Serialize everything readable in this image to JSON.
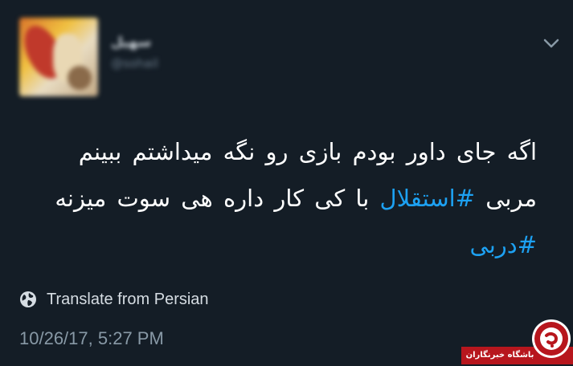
{
  "tweet": {
    "display_name": "سهیل",
    "handle": "@sohail",
    "body": {
      "line1": "اگه جای داور بودم بازی رو نگه میداشتم ببینم",
      "line2_prefix": "مربی ",
      "line2_hashtag": "#استقلال",
      "line2_suffix": " با کی کار داره هی سوت میزنه",
      "line3_hashtag": "#دربی"
    },
    "translate_label": "Translate from Persian",
    "timestamp": "10/26/17, 5:27 PM"
  },
  "icons": {
    "menu": "chevron-down-icon",
    "translate": "globe-icon"
  },
  "watermark": {
    "text": "باشگاه خبرنگاران"
  },
  "colors": {
    "background": "#141d26",
    "text": "#ffffff",
    "hashtag": "#1da1f2",
    "muted": "#8899a6",
    "watermark_red": "#b7161d"
  }
}
